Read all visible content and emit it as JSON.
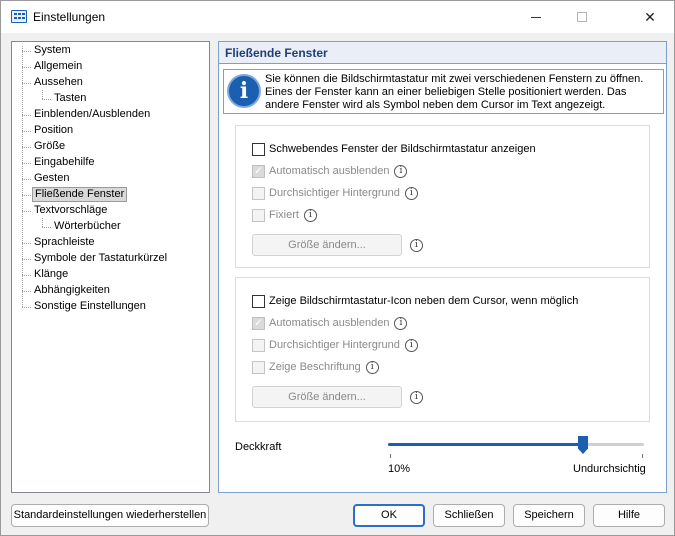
{
  "window": {
    "title": "Einstellungen"
  },
  "tree": [
    {
      "label": "System",
      "level": 0
    },
    {
      "label": "Allgemein",
      "level": 0
    },
    {
      "label": "Aussehen",
      "level": 0
    },
    {
      "label": "Tasten",
      "level": 1
    },
    {
      "label": "Einblenden/Ausblenden",
      "level": 0
    },
    {
      "label": "Position",
      "level": 0
    },
    {
      "label": "Größe",
      "level": 0
    },
    {
      "label": "Eingabehilfe",
      "level": 0
    },
    {
      "label": "Gesten",
      "level": 0
    },
    {
      "label": "Fließende Fenster",
      "level": 0,
      "selected": true
    },
    {
      "label": "Textvorschläge",
      "level": 0
    },
    {
      "label": "Wörterbücher",
      "level": 1
    },
    {
      "label": "Sprachleiste",
      "level": 0
    },
    {
      "label": "Symbole der Tastaturkürzel",
      "level": 0
    },
    {
      "label": "Klänge",
      "level": 0
    },
    {
      "label": "Abhängigkeiten",
      "level": 0
    },
    {
      "label": "Sonstige Einstellungen",
      "level": 0
    }
  ],
  "panel": {
    "title": "Fließende Fenster",
    "info": "Sie können die Bildschirmtastatur mit zwei verschiedenen Fenstern zu öffnen. Eines der Fenster kann an einer beliebigen Stelle positioniert werden. Das andere Fenster wird als Symbol neben dem Cursor im Text angezeigt.",
    "group1": {
      "main": {
        "label": "Schwebendes Fenster der Bildschirmtastatur anzeigen",
        "checked": false,
        "enabled": true
      },
      "auto_hide": {
        "label": "Automatisch ausblenden",
        "checked": true,
        "enabled": false
      },
      "transparent": {
        "label": "Durchsichtiger Hintergrund",
        "checked": false,
        "enabled": false
      },
      "fixed": {
        "label": "Fixiert",
        "checked": false,
        "enabled": false
      },
      "resize_button": "Größe ändern..."
    },
    "group2": {
      "main": {
        "label": "Zeige Bildschirmtastatur-Icon neben dem Cursor, wenn möglich",
        "checked": false,
        "enabled": true
      },
      "auto_hide": {
        "label": "Automatisch ausblenden",
        "checked": true,
        "enabled": false
      },
      "transparent": {
        "label": "Durchsichtiger Hintergrund",
        "checked": false,
        "enabled": false
      },
      "caption": {
        "label": "Zeige Beschriftung",
        "checked": false,
        "enabled": false
      },
      "resize_button": "Größe ändern..."
    },
    "opacity": {
      "label": "Deckkraft",
      "min_label": "10%",
      "max_label": "Undurchsichtig",
      "value_fraction": 0.76
    }
  },
  "buttons": {
    "restore": "Standardeinstellungen wiederherstellen",
    "ok": "OK",
    "close": "Schließen",
    "save": "Speichern",
    "help": "Hilfe"
  },
  "icons": {
    "info": "i",
    "help": "i",
    "window_close": "✕"
  },
  "colors": {
    "accent": "#1b5fb0",
    "panel_border": "#7aa0cd",
    "header_text": "#1f3f78"
  }
}
